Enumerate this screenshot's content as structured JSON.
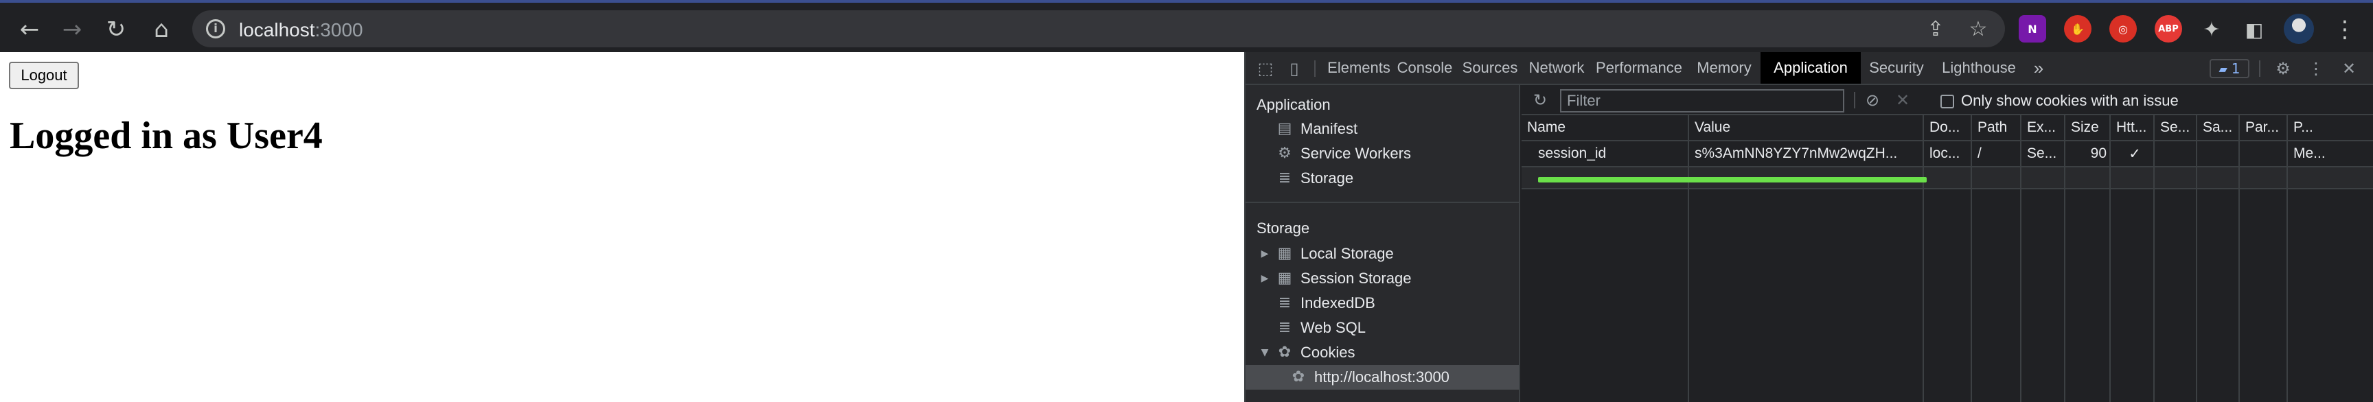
{
  "browser": {
    "url_host": "localhost",
    "url_port": ":3000",
    "icons": {
      "back": "arrow-left-icon",
      "forward": "arrow-right-icon",
      "reload": "reload-icon",
      "home": "home-icon",
      "share": "share-icon",
      "bookmark": "star-icon"
    },
    "extensions": [
      {
        "name": "onenote-extension",
        "label": "N",
        "color": "#7719aa"
      },
      {
        "name": "stop-extension",
        "label": "✋",
        "color": "#d93025"
      },
      {
        "name": "target-extension",
        "label": "◎",
        "color": "#d93025"
      },
      {
        "name": "adblock-plus-extension",
        "label": "ABP",
        "color": "#e53935"
      }
    ]
  },
  "page": {
    "logout_label": "Logout",
    "title": "Logged in as User4"
  },
  "devtools": {
    "tabs": [
      "Elements",
      "Console",
      "Sources",
      "Network",
      "Performance",
      "Memory",
      "Application",
      "Security",
      "Lighthouse"
    ],
    "active_tab": "Application",
    "more_tabs": "»",
    "issues_count": "1",
    "sidebar": {
      "application_heading": "Application",
      "application_items": [
        "Manifest",
        "Service Workers",
        "Storage"
      ],
      "storage_heading": "Storage",
      "storage_items": [
        "Local Storage",
        "Session Storage",
        "IndexedDB",
        "Web SQL",
        "Cookies"
      ],
      "cookie_origin": "http://localhost:3000"
    },
    "filter": {
      "placeholder": "Filter",
      "only_issues_label": "Only show cookies with an issue"
    },
    "cookie_table": {
      "columns": [
        "Name",
        "Value",
        "Do...",
        "Path",
        "Ex...",
        "Size",
        "Htt...",
        "Se...",
        "Sa...",
        "Par...",
        "P..."
      ],
      "rows": [
        [
          "session_id",
          "s%3AmNN8YZY7nMw2wqZH...",
          "loc...",
          "/",
          "Se...",
          "90",
          "✓",
          "",
          "",
          "",
          "Me..."
        ]
      ],
      "highlight_color": "#6be04a"
    }
  }
}
